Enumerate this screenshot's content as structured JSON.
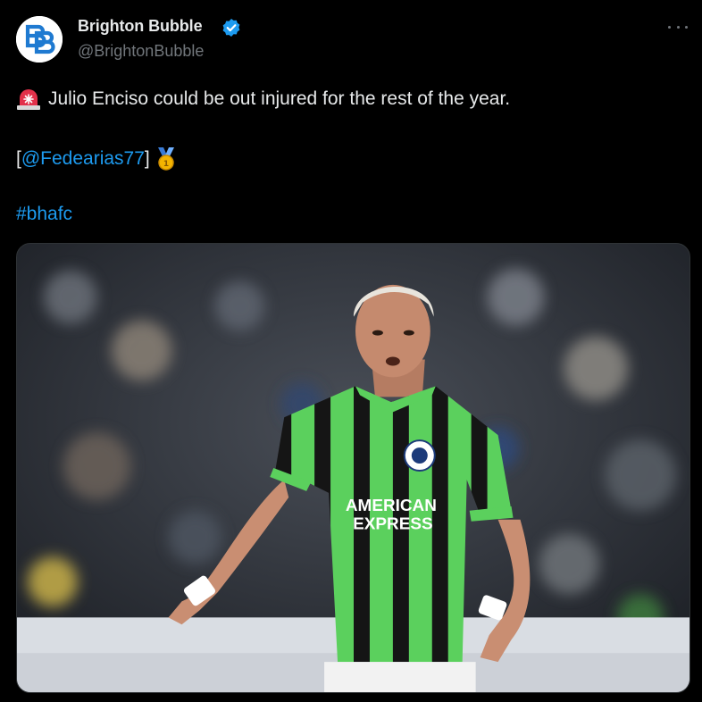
{
  "author": {
    "display_name": "Brighton Bubble",
    "handle": "@BrightonBubble",
    "avatar_letters": "BB",
    "verified_icon": "verified-badge-icon"
  },
  "tweet": {
    "line1_emoji": "police-light-icon",
    "line1_text": "Julio Enciso could be out injured for the rest of the year.",
    "line2_open": "[",
    "line2_mention": "@Fedearias77",
    "line2_close": "]",
    "line2_emoji": "gold-medal-icon",
    "hashtag": "#bhafc"
  },
  "media": {
    "sponsor_line1": "AMERICAN",
    "sponsor_line2": "EXPRESS"
  },
  "colors": {
    "background": "#000000",
    "text": "#e7e9ea",
    "muted": "#71767b",
    "link": "#1d9bf0",
    "kit_green": "#5bd05d"
  }
}
